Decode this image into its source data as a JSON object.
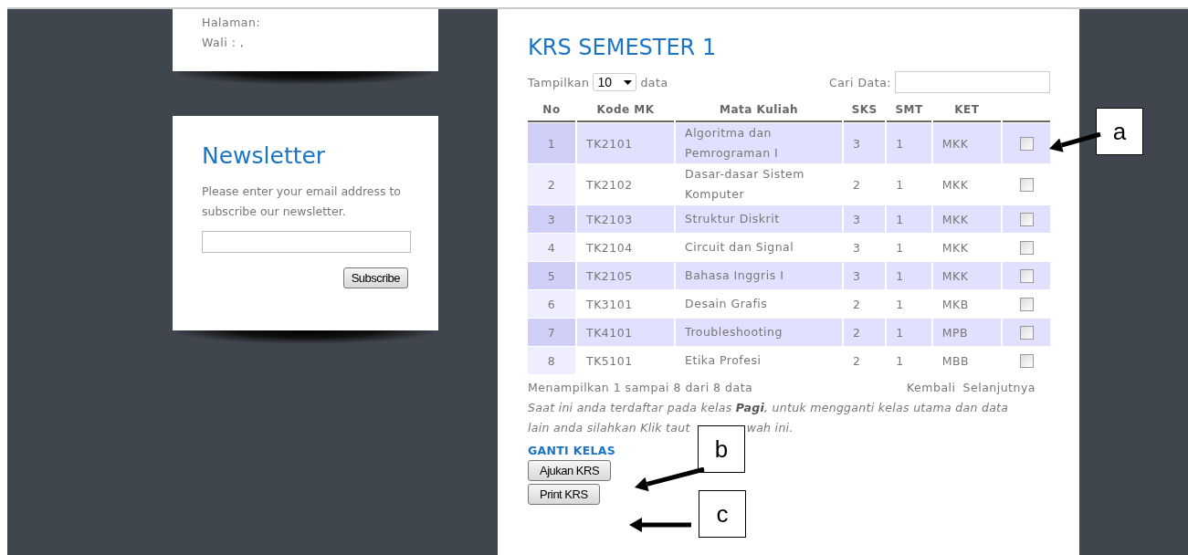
{
  "profile_card": {
    "lines": [
      "Halaman:",
      "Wali : ,"
    ]
  },
  "newsletter": {
    "title": "Newsletter",
    "text": "Please enter your email address to subscribe our newsletter.",
    "button": "Subscribe"
  },
  "krs": {
    "title": "KRS SEMESTER 1",
    "show_label": "Tampilkan",
    "page_size": "10",
    "show_suffix": "data",
    "search_label": "Cari Data:",
    "columns": [
      "No",
      "Kode MK",
      "Mata Kuliah",
      "SKS",
      "SMT",
      "KET"
    ],
    "rows": [
      {
        "no": "1",
        "code": "TK2101",
        "course": "Algoritma dan Pemrograman I",
        "sks": "3",
        "smt": "1",
        "ket": "MKK",
        "checked": false
      },
      {
        "no": "2",
        "code": "TK2102",
        "course": "Dasar-dasar Sistem Komputer",
        "sks": "2",
        "smt": "1",
        "ket": "MKK",
        "checked": false
      },
      {
        "no": "3",
        "code": "TK2103",
        "course": "Struktur Diskrit",
        "sks": "3",
        "smt": "1",
        "ket": "MKK",
        "checked": false
      },
      {
        "no": "4",
        "code": "TK2104",
        "course": "Circuit dan Signal",
        "sks": "3",
        "smt": "1",
        "ket": "MKK",
        "checked": false
      },
      {
        "no": "5",
        "code": "TK2105",
        "course": "Bahasa Inggris I",
        "sks": "3",
        "smt": "1",
        "ket": "MKK",
        "checked": false
      },
      {
        "no": "6",
        "code": "TK3101",
        "course": "Desain Grafis",
        "sks": "2",
        "smt": "1",
        "ket": "MKB",
        "checked": false
      },
      {
        "no": "7",
        "code": "TK4101",
        "course": "Troubleshooting",
        "sks": "2",
        "smt": "1",
        "ket": "MPB",
        "checked": false
      },
      {
        "no": "8",
        "code": "TK5101",
        "course": "Etika Profesi",
        "sks": "2",
        "smt": "1",
        "ket": "MBB",
        "checked": false
      }
    ],
    "info": "Menampilkan 1 sampai 8 dari 8 data",
    "prev": "Kembali",
    "next": "Selanjutnya",
    "note_lines": [
      "Saat ini anda terdaftar pada kelas **Pagi**, untuk mengganti kelas utama dan data",
      "lain anda silahkan Klik taut",
      "wah ini."
    ],
    "change_class": "GANTI KELAS",
    "buttons": [
      "Ajukan KRS",
      "Print KRS"
    ]
  },
  "callouts": [
    "a",
    "b",
    "c"
  ]
}
